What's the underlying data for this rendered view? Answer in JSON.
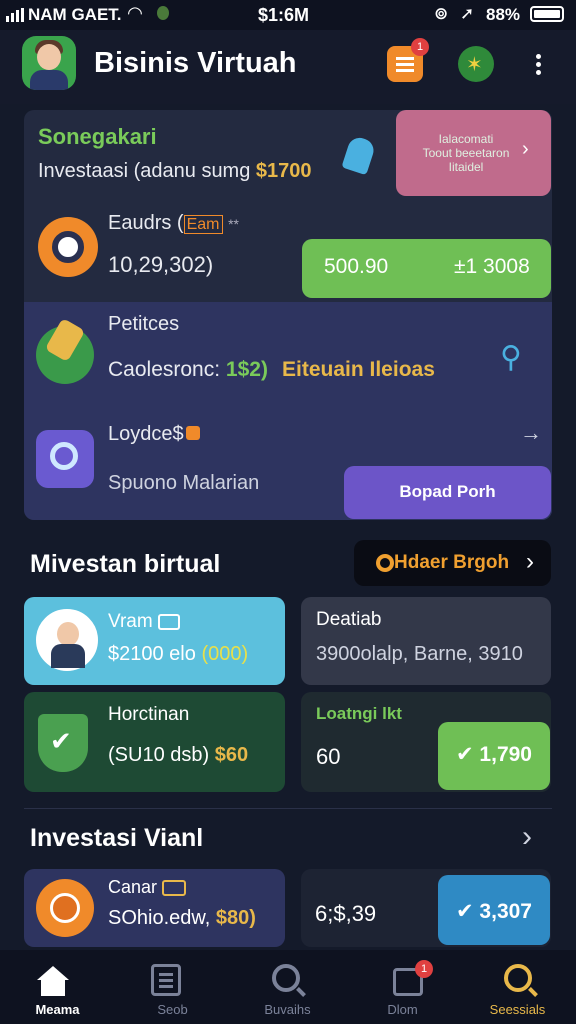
{
  "status_bar": {
    "carrier": "NAM GAET.",
    "time": "$1:6M",
    "battery": "88%"
  },
  "header": {
    "title": "Bisinis Virtuah",
    "notif_badge": "1"
  },
  "top_section": {
    "greeting": "Sonegakari",
    "subtitle": "Investaasi (adanu sumg",
    "subtitle_value": "$1700",
    "promo_text": "Ialacomati\nToout beeetaron\nIitaidel"
  },
  "item1": {
    "title": "Eaudrs (",
    "title_badge": "Eam",
    "title_suffix": "**",
    "value": "10,29,302)",
    "pill_left": "500.90",
    "pill_right": "±1 3008"
  },
  "item2": {
    "title": "Petitces",
    "label": "Caolesronc:",
    "label_value": "1$2)",
    "highlight": "Eiteuain Ileioas"
  },
  "item3": {
    "title": "Loydce$",
    "subtitle": "Spuono Malarian",
    "button": "Bopad Porh"
  },
  "section1": {
    "title": "Mivestan birtual",
    "button": "Hdaer Brgoh"
  },
  "grid": [
    {
      "title": "Vram",
      "value": "$2100 elo",
      "value_hl": "(000)"
    },
    {
      "title": "Deatiab",
      "value": "3900olalp, Barne, 3910"
    },
    {
      "title": "Horctinan",
      "value": "(SU10 dsb)",
      "value_hl": "$60"
    },
    {
      "title": "Loatngi lkt",
      "value": "60",
      "pill": "✔ 1,790"
    }
  ],
  "section2": {
    "title": "Investasi Vianl"
  },
  "bottom_row": [
    {
      "title": "Canar",
      "value": "SOhio.edw,",
      "value_hl": "$80)"
    },
    {
      "value": "6;$,39",
      "pill": "✔ 3,307"
    }
  ],
  "nav": [
    {
      "label": "Meama"
    },
    {
      "label": "Seob"
    },
    {
      "label": "Buvaihs"
    },
    {
      "label": "Dlom",
      "badge": "1"
    },
    {
      "label": "Seessials"
    }
  ],
  "colors": {
    "accent_green": "#6fbf55",
    "accent_purple": "#6c55c8",
    "accent_blue": "#2f8ac4",
    "gold": "#e8b84a"
  }
}
